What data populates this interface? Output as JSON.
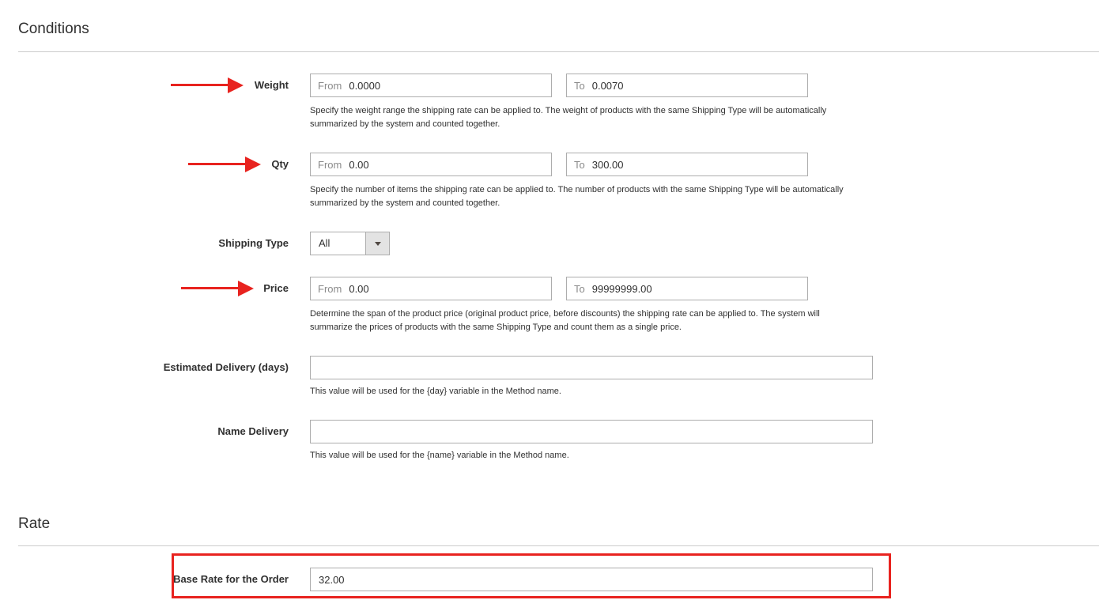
{
  "conditions": {
    "title": "Conditions",
    "weight": {
      "label": "Weight",
      "from_prefix": "From",
      "from_value": "0.0000",
      "to_prefix": "To",
      "to_value": "0.0070",
      "note": "Specify the weight range the shipping rate can be applied to. The weight of products with the same Shipping Type will be automatically summarized by the system and counted together."
    },
    "qty": {
      "label": "Qty",
      "from_prefix": "From",
      "from_value": "0.00",
      "to_prefix": "To",
      "to_value": "300.00",
      "note": "Specify the number of items the shipping rate can be applied to. The number of products with the same Shipping Type will be automatically summarized by the system and counted together."
    },
    "shipping_type": {
      "label": "Shipping Type",
      "selected": "All"
    },
    "price": {
      "label": "Price",
      "from_prefix": "From",
      "from_value": "0.00",
      "to_prefix": "To",
      "to_value": "99999999.00",
      "note": "Determine the span of the product price (original product price, before discounts) the shipping rate can be applied to. The system will summarize the prices of products with the same Shipping Type and count them as a single price."
    },
    "estimated_delivery": {
      "label": "Estimated Delivery (days)",
      "value": "",
      "note": "This value will be used for the {day} variable in the Method name."
    },
    "name_delivery": {
      "label": "Name Delivery",
      "value": "",
      "note": "This value will be used for the {name} variable in the Method name."
    }
  },
  "rate": {
    "title": "Rate",
    "base_rate": {
      "label": "Base Rate for the Order",
      "value": "32.00"
    }
  },
  "annotation_color": "#e8231f",
  "icons": {
    "select_toggle": "chevron-down-icon",
    "annotation_arrow": "arrow-right-icon"
  }
}
